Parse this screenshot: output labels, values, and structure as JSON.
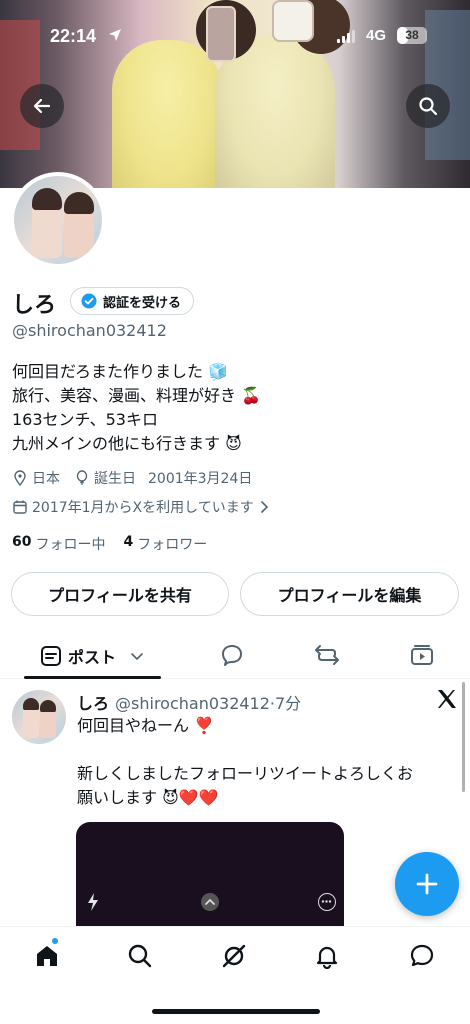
{
  "status": {
    "time": "22:14",
    "network": "4G",
    "battery": "38",
    "battery_fraction": 0.38
  },
  "profile": {
    "name": "しろ",
    "verify_label": "認証を受ける",
    "handle": "@shirochan032412",
    "bio": [
      "何回目だろまた作りました 🧊",
      "旅行、美容、漫画、料理が好き 🍒",
      "163センチ、53キロ",
      "九州メインの他にも行きます 😈"
    ],
    "location": "日本",
    "birthday_label": "誕生日",
    "birthday": "2001年3月24日",
    "joined": "2017年1月からXを利用しています",
    "following_count": "60",
    "following_label": "フォロー中",
    "followers_count": "4",
    "followers_label": "フォロワー"
  },
  "actions": {
    "share": "プロフィールを共有",
    "edit": "プロフィールを編集"
  },
  "tabs": {
    "posts": "ポスト"
  },
  "post": {
    "name": "しろ",
    "handle_time": "@shirochan032412·7分",
    "lines": [
      "何回目やねーん ❣️",
      "",
      "新しくしましたフォローリツイートよろしくお",
      "願いします 😈❤️❤️"
    ]
  },
  "colors": {
    "accent": "#1d9bf0",
    "text": "#0f1419",
    "secondary": "#536471",
    "border": "#cfd9de"
  },
  "icons": {
    "back": "back-arrow-icon",
    "search": "search-icon",
    "verified": "verified-badge-icon",
    "location": "location-pin-icon",
    "birthday": "balloon-icon",
    "calendar": "calendar-icon",
    "fab": "plus-icon",
    "nav": [
      "home-icon",
      "search-icon",
      "grok-icon",
      "bell-icon",
      "messages-icon"
    ]
  }
}
